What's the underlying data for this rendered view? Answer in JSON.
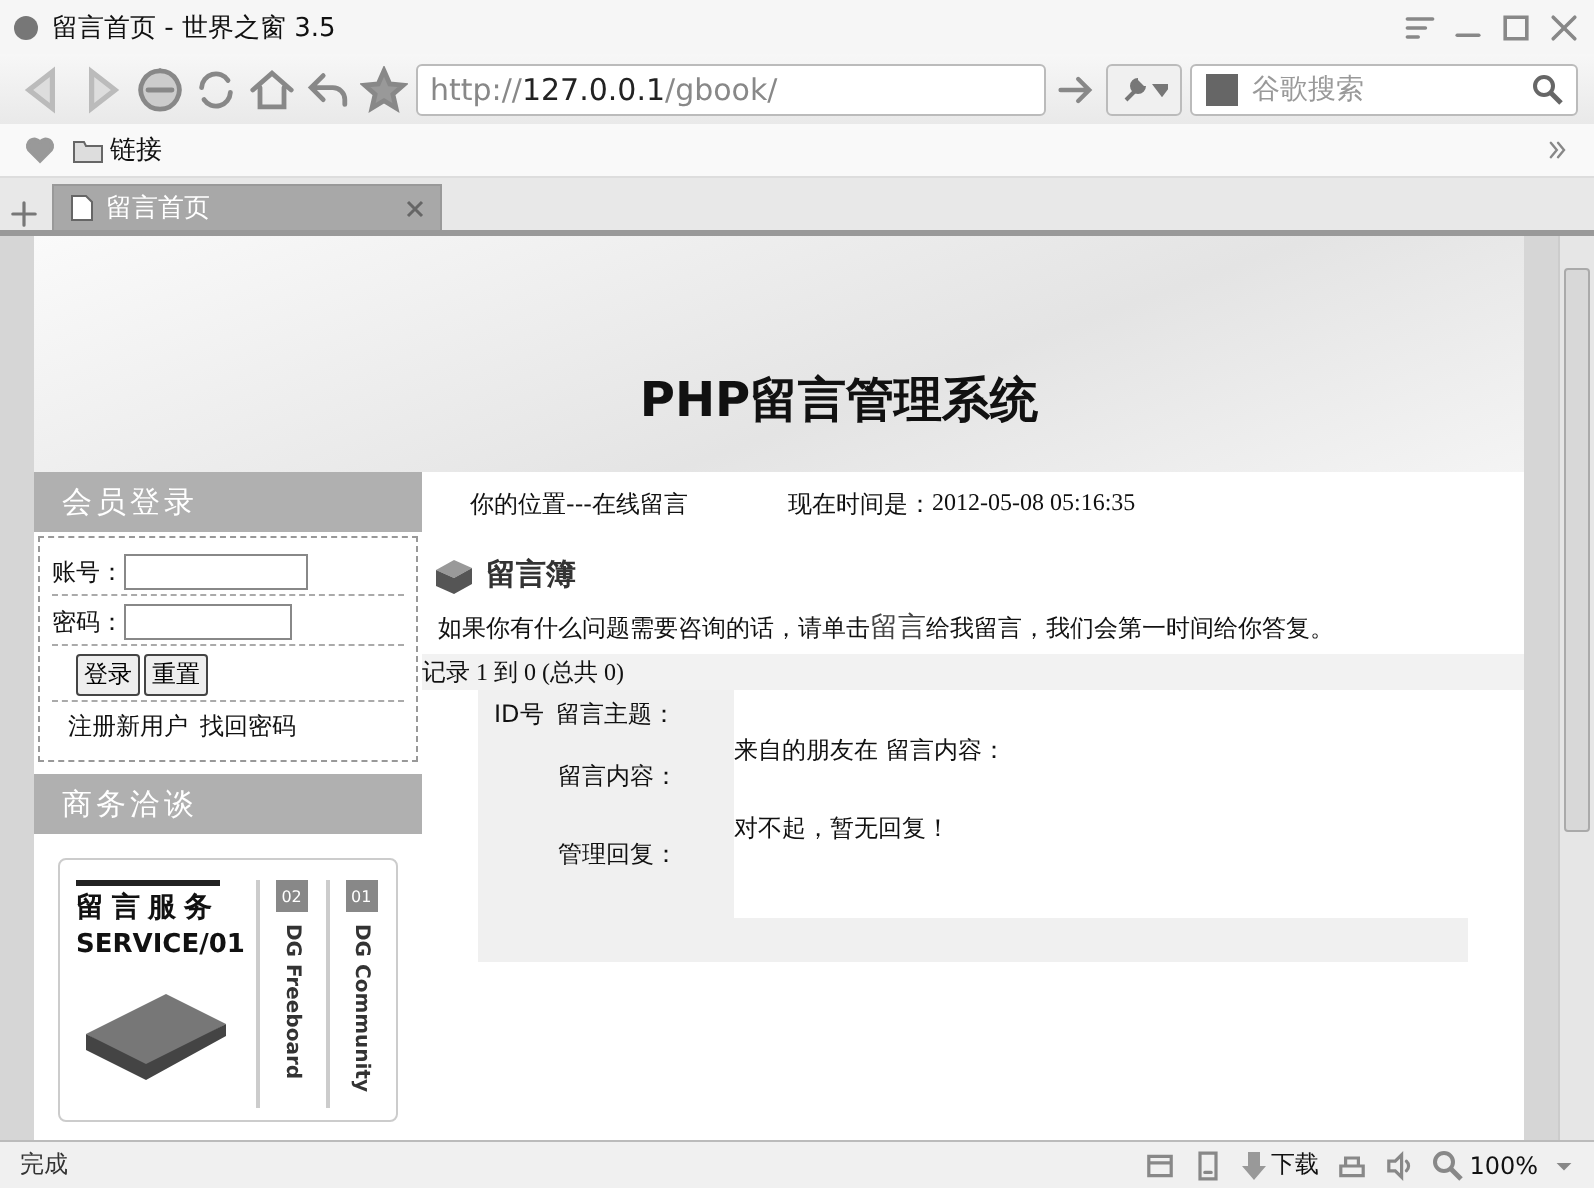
{
  "window": {
    "title": "留言首页 - 世界之窗 3.5"
  },
  "toolbar": {
    "address_scheme": "http://",
    "address_host": "127.0.0.1",
    "address_path": "/gbook/",
    "search_placeholder": "谷歌搜索"
  },
  "bookmarks": [
    {
      "label": "链接"
    }
  ],
  "tabs": [
    {
      "label": "留言首页",
      "selected": true
    }
  ],
  "banner": {
    "title": "PHP留言管理系统"
  },
  "sidebar": {
    "login": {
      "title": "会员登录",
      "fields": [
        {
          "label": "账号："
        },
        {
          "label": "密码："
        }
      ],
      "buttons": [
        "登录",
        "重置"
      ],
      "links": [
        "注册新用户",
        "找回密码"
      ]
    },
    "business": {
      "title": "商务洽谈",
      "ad": {
        "heading": "留言服务",
        "subheading": "SERVICE/01",
        "tabs": [
          {
            "number": "02",
            "label": "DG Freeboard"
          },
          {
            "number": "01",
            "label": "DG Community"
          }
        ]
      }
    }
  },
  "main": {
    "location": "你的位置---在线留言",
    "time_label": "现在时间是：",
    "time": "2012-05-08 05:16:35",
    "heading": "留言簿",
    "intro_before": "如果你有什么问题需要咨询的话，请单击",
    "intro_link": "留言",
    "intro_after": "给我留言，我们会第一时间给你答复。",
    "records": "记录  1 到  0 (总共  0)",
    "entry": {
      "id_label": "ID号",
      "subject_label": "留言主题：",
      "content_label": "留言内容：",
      "content_value": "来自的朋友在 留言内容：",
      "reply_label": "管理回复：",
      "reply_value": "对不起，暂无回复！"
    }
  },
  "status_bar": {
    "status": "完成",
    "download": "下载",
    "zoom": "100%"
  }
}
